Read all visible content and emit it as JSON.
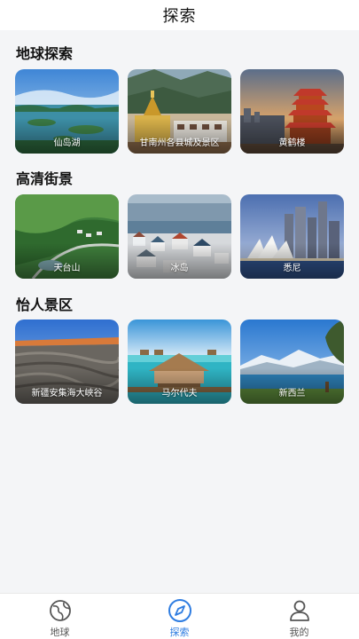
{
  "header": {
    "title": "探索"
  },
  "sections": [
    {
      "title": "地球探索",
      "cards": [
        {
          "label": "仙岛湖"
        },
        {
          "label": "甘南州各县城及景区"
        },
        {
          "label": "黄鹤楼"
        }
      ]
    },
    {
      "title": "高清街景",
      "cards": [
        {
          "label": "天台山"
        },
        {
          "label": "冰岛"
        },
        {
          "label": "悉尼"
        }
      ]
    },
    {
      "title": "怡人景区",
      "cards": [
        {
          "label": "新疆安集海大峡谷"
        },
        {
          "label": "马尔代夫"
        },
        {
          "label": "新西兰"
        }
      ]
    }
  ],
  "tabbar": {
    "active_color": "#2f7de1",
    "items": [
      {
        "label": "地球",
        "icon": "globe-icon",
        "active": false
      },
      {
        "label": "探索",
        "icon": "compass-icon",
        "active": true
      },
      {
        "label": "我的",
        "icon": "user-icon",
        "active": false
      }
    ]
  }
}
